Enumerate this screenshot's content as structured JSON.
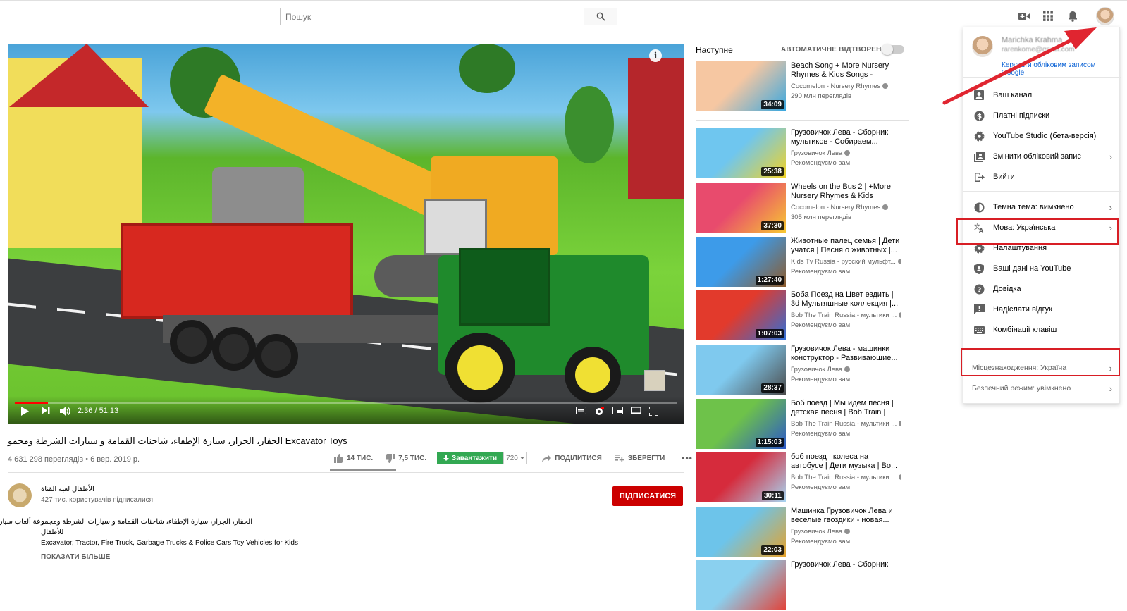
{
  "header": {
    "search_placeholder": "Пошук"
  },
  "player": {
    "time": "2:36 / 51:13",
    "progress": 0.05,
    "info": "i"
  },
  "video": {
    "title": "الحفار، الجرار، سيارة الإطفاء، شاحنات القمامة و سيارات الشرطة ومجمو Excavator Toys",
    "meta": "4 631 298 переглядів • 6 вер. 2019 р.",
    "likes": "14 ТИС.",
    "dislikes": "7,5 ТИС.",
    "download": "Завантажити",
    "quality": "720",
    "share": "ПОДІЛИТИСЯ",
    "save": "ЗБЕРЕГТИ",
    "more": "•••"
  },
  "channel": {
    "name": "الأطفال لعبة القناة",
    "subscribers": "427 тис. користувачів підписалися",
    "subscribe": "ПІДПИСАТИСЯ",
    "desc_line1": "الحفار، الجرار، سيارة الإطفاء، شاحنات القمامة و سيارات الشرطة ومجموعة ألعاب سيارات",
    "desc_line2": "للأطفال",
    "desc_line3": "Excavator, Tractor, Fire Truck, Garbage Trucks & Police Cars Toy Vehicles for Kids",
    "show_more": "ПОКАЗАТИ БІЛЬШЕ"
  },
  "sidebar": {
    "next_label": "Наступне",
    "autoplay_label": "АВТОМАТИЧНЕ ВІДТВОРЕННЯ",
    "items": [
      {
        "title": "Beach Song + More Nursery Rhymes & Kids Songs -",
        "channel": "Cocomelon - Nursery Rhymes",
        "extra": "290 млн переглядів",
        "duration": "34:09",
        "color1": "#f6c7a2",
        "color2": "#37a7e0"
      },
      {
        "title": "Грузовичок Лева - Сборник мультиков - Собираем...",
        "channel": "Грузовичок Лева",
        "extra": "Рекомендуємо вам",
        "duration": "25:38",
        "color1": "#6fc6ef",
        "color2": "#f2d326"
      },
      {
        "title": "Wheels on the Bus 2 | +More Nursery Rhymes & Kids Songs...",
        "channel": "Cocomelon - Nursery Rhymes",
        "extra": "305 млн переглядів",
        "duration": "37:30",
        "color1": "#e84b6d",
        "color2": "#f7c832"
      },
      {
        "title": "Животные палец семья | Дети учатся | Песня о животных |...",
        "channel": "Kids Tv Russia - русский мульфт...",
        "extra": "Рекомендуємо вам",
        "duration": "1:27:40",
        "color1": "#3d9be9",
        "color2": "#8c5a2b"
      },
      {
        "title": "Боба Поезд на Цвет ездить | 3d Мультяшные коллекция |...",
        "channel": "Bob The Train Russia - мультики ...",
        "extra": "Рекомендуємо вам",
        "duration": "1:07:03",
        "color1": "#e23a2c",
        "color2": "#2f6fd8"
      },
      {
        "title": "Грузовичок Лева - машинки конструктор - Развивающие...",
        "channel": "Грузовичок Лева",
        "extra": "Рекомендуємо вам",
        "duration": "28:37",
        "color1": "#7fc9ee",
        "color2": "#4c4c4c"
      },
      {
        "title": "Боб поезд | Мы идем песня | детская песня | Bob Train | W...",
        "channel": "Bob The Train Russia - мультики ...",
        "extra": "Рекомендуємо вам",
        "duration": "1:15:03",
        "color1": "#6ec24a",
        "color2": "#2b58c8"
      },
      {
        "title": "боб поезд | колеса на автобусе | Дети музыка | Во...",
        "channel": "Bob The Train Russia - мультики ...",
        "extra": "Рекомендуємо вам",
        "duration": "30:11",
        "color1": "#d62b3c",
        "color2": "#a6d6f3"
      },
      {
        "title": "Машинка Грузовичок Лева и веселые гвоздики - новая...",
        "channel": "Грузовичок Лева",
        "extra": "Рекомендуємо вам",
        "duration": "22:03",
        "color1": "#6dc4ea",
        "color2": "#e6a22a"
      },
      {
        "title": "Грузовичок Лева - Сборник",
        "channel": "",
        "extra": "",
        "duration": "",
        "color1": "#8ad0ef",
        "color2": "#e24238"
      }
    ]
  },
  "menu": {
    "name": "Marichka Krahma",
    "email": "rarenkome@gmail.com",
    "manage": "Керувати обліковим записом Google",
    "items": [
      {
        "label": "Ваш канал",
        "icon": "person-icon"
      },
      {
        "label": "Платні підписки",
        "icon": "dollar-icon"
      },
      {
        "label": "YouTube Studio (бета-версія)",
        "icon": "gear-icon"
      },
      {
        "label": "Змінити обліковий запис",
        "icon": "switch-account-icon"
      },
      {
        "label": "Вийти",
        "icon": "sign-out-icon"
      },
      {
        "label": "Темна тема: вимкнено",
        "icon": "dark-theme-icon"
      },
      {
        "label": "Мова: Українська",
        "icon": "translate-icon"
      },
      {
        "label": "Налаштування",
        "icon": "gear-icon"
      },
      {
        "label": "Ваші дані на YouTube",
        "icon": "shield-icon"
      },
      {
        "label": "Довідка",
        "icon": "help-icon"
      },
      {
        "label": "Надіслати відгук",
        "icon": "feedback-icon"
      },
      {
        "label": "Комбінації клавіш",
        "icon": "keyboard-icon"
      }
    ],
    "location": "Місцезнаходження: Україна",
    "safe_mode": "Безпечний режим: увімкнено"
  },
  "colors": {
    "accent_red": "#cc0000",
    "download_green": "#32a852",
    "annotation_red": "#d81e25",
    "link_blue": "#065fd4"
  }
}
